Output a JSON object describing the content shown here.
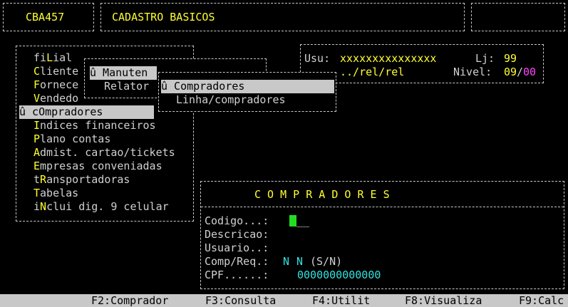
{
  "header": {
    "program_code": "CBA457",
    "title": "CADASTRO BASICOS"
  },
  "info": {
    "usu_label": "Usu:",
    "usu_value": "xxxxxxxxxxxxxxx",
    "lj_label": "Lj:",
    "lj_value": "99",
    "path": "../rel/rel",
    "nivel_label": "Nivel:",
    "nivel_value": "09",
    "nivel_sep": "/",
    "nivel_max": "00"
  },
  "main_menu": {
    "items": [
      {
        "pre": "fi",
        "hot": "L",
        "post": "ial"
      },
      {
        "pre": "",
        "hot": "C",
        "post": "liente"
      },
      {
        "pre": "",
        "hot": "F",
        "post": "ornece"
      },
      {
        "pre": "",
        "hot": "V",
        "post": "endedo"
      },
      {
        "pre": "û c",
        "hot": "O",
        "post": "mpradores"
      },
      {
        "pre": "",
        "hot": "I",
        "post": "ndices financeiros"
      },
      {
        "pre": "",
        "hot": "P",
        "post": "lano contas"
      },
      {
        "pre": "",
        "hot": "A",
        "post": "dmist. cartao/tickets"
      },
      {
        "pre": "",
        "hot": "E",
        "post": "mpresas conveniadas"
      },
      {
        "pre": "t",
        "hot": "R",
        "post": "ansportadoras"
      },
      {
        "pre": "",
        "hot": "T",
        "post": "abelas"
      },
      {
        "pre": "i",
        "hot": "N",
        "post": "clui dig. 9 celular"
      }
    ]
  },
  "submenu": {
    "item1": "û Manuten",
    "item2": "Relator"
  },
  "submenu2": {
    "item1": "û Compradores",
    "item2": "Linha/compradores"
  },
  "form": {
    "title": "C O M P R A D O R E S",
    "codigo_label": "Codigo...:",
    "codigo_tail": "__",
    "descricao_label": "Descricao:",
    "usuario_label": "Usuario..:",
    "compreq_label": "Comp/Req.:",
    "comp_value": "N",
    "req_value": "N",
    "compreq_hint": "(S/N)",
    "cpf_label": "CPF......:",
    "cpf_value": "0000000000000"
  },
  "fkeys": [
    "F2:Comprador",
    "F3:Consulta",
    "F4:Utilit",
    "F8:Visualiza",
    "F9:Calc"
  ],
  "colors": {
    "hotkey": "#ffff33",
    "value": "#33e0e0",
    "accent": "#ff44ff",
    "cursor": "#22dd22"
  }
}
